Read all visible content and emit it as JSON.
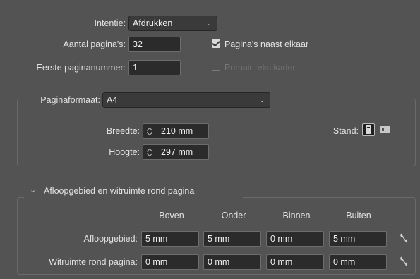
{
  "intent": {
    "label": "Intentie:",
    "value": "Afdrukken"
  },
  "pages": {
    "label": "Aantal pagina's:",
    "value": "32"
  },
  "start_page": {
    "label": "Eerste paginanummer:",
    "value": "1"
  },
  "facing_pages": {
    "label": "Pagina's naast elkaar",
    "checked": true
  },
  "primary_frame": {
    "label": "Primair tekstkader",
    "checked": false
  },
  "page_size": {
    "label": "Paginaformaat:",
    "value": "A4"
  },
  "width": {
    "label": "Breedte:",
    "value": "210 mm"
  },
  "height": {
    "label": "Hoogte:",
    "value": "297 mm"
  },
  "orientation": {
    "label": "Stand:",
    "icons": [
      "portrait-icon",
      "landscape-icon"
    ],
    "selected": "portrait"
  },
  "bleed_section": {
    "title": "Afloopgebied en witruimte rond pagina",
    "columns": [
      "Boven",
      "Onder",
      "Binnen",
      "Buiten"
    ],
    "rows": [
      {
        "label": "Afloopgebied:",
        "values": [
          "5 mm",
          "5 mm",
          "0 mm",
          "5 mm"
        ]
      },
      {
        "label": "Witruimte rond pagina:",
        "values": [
          "0 mm",
          "0 mm",
          "0 mm",
          "0 mm"
        ]
      }
    ]
  }
}
